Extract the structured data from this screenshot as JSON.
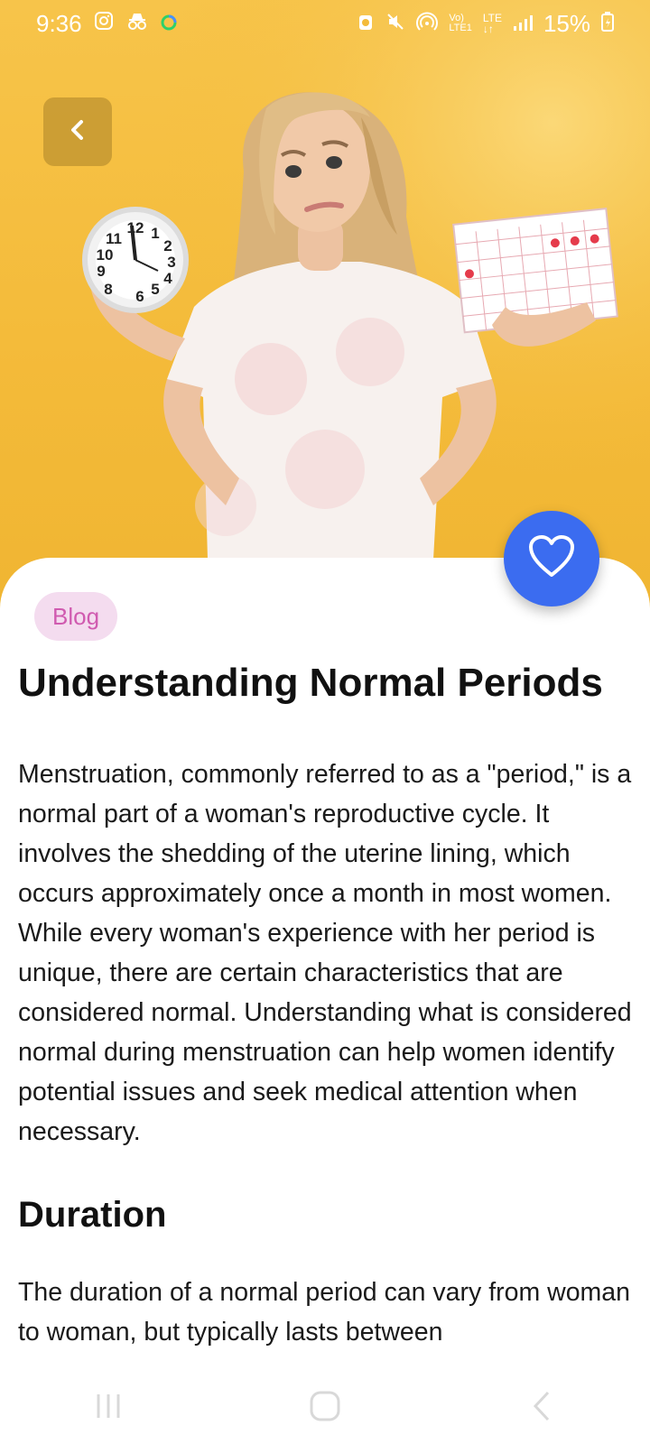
{
  "status_bar": {
    "time": "9:36",
    "battery": "15%",
    "icons": [
      "instagram-icon",
      "incognito-icon",
      "loading-ring-icon",
      "alarm-icon",
      "mute-icon",
      "hotspot-icon",
      "volte-icon",
      "lte-icon",
      "signal-icon",
      "battery-icon"
    ]
  },
  "article": {
    "tag": "Blog",
    "title": "Understanding Normal Periods",
    "intro": "Menstruation, commonly referred to as a \"period,\" is a normal part of a woman's reproductive cycle. It involves the shedding of the uterine lining, which occurs approximately once a month in most women. While every woman's experience with her period is unique, there are certain characteristics that are considered normal. Understanding what is considered normal during menstruation can help women identify potential issues and seek medical attention when necessary.",
    "section_heading": "Duration",
    "section_text": "The duration of a normal period can vary from woman to woman, but typically lasts between"
  },
  "colors": {
    "hero_background": "#f4bb3a",
    "favorite_button": "#3b6cf0",
    "tag_background": "#f4dcef",
    "tag_text": "#d05bb0"
  }
}
